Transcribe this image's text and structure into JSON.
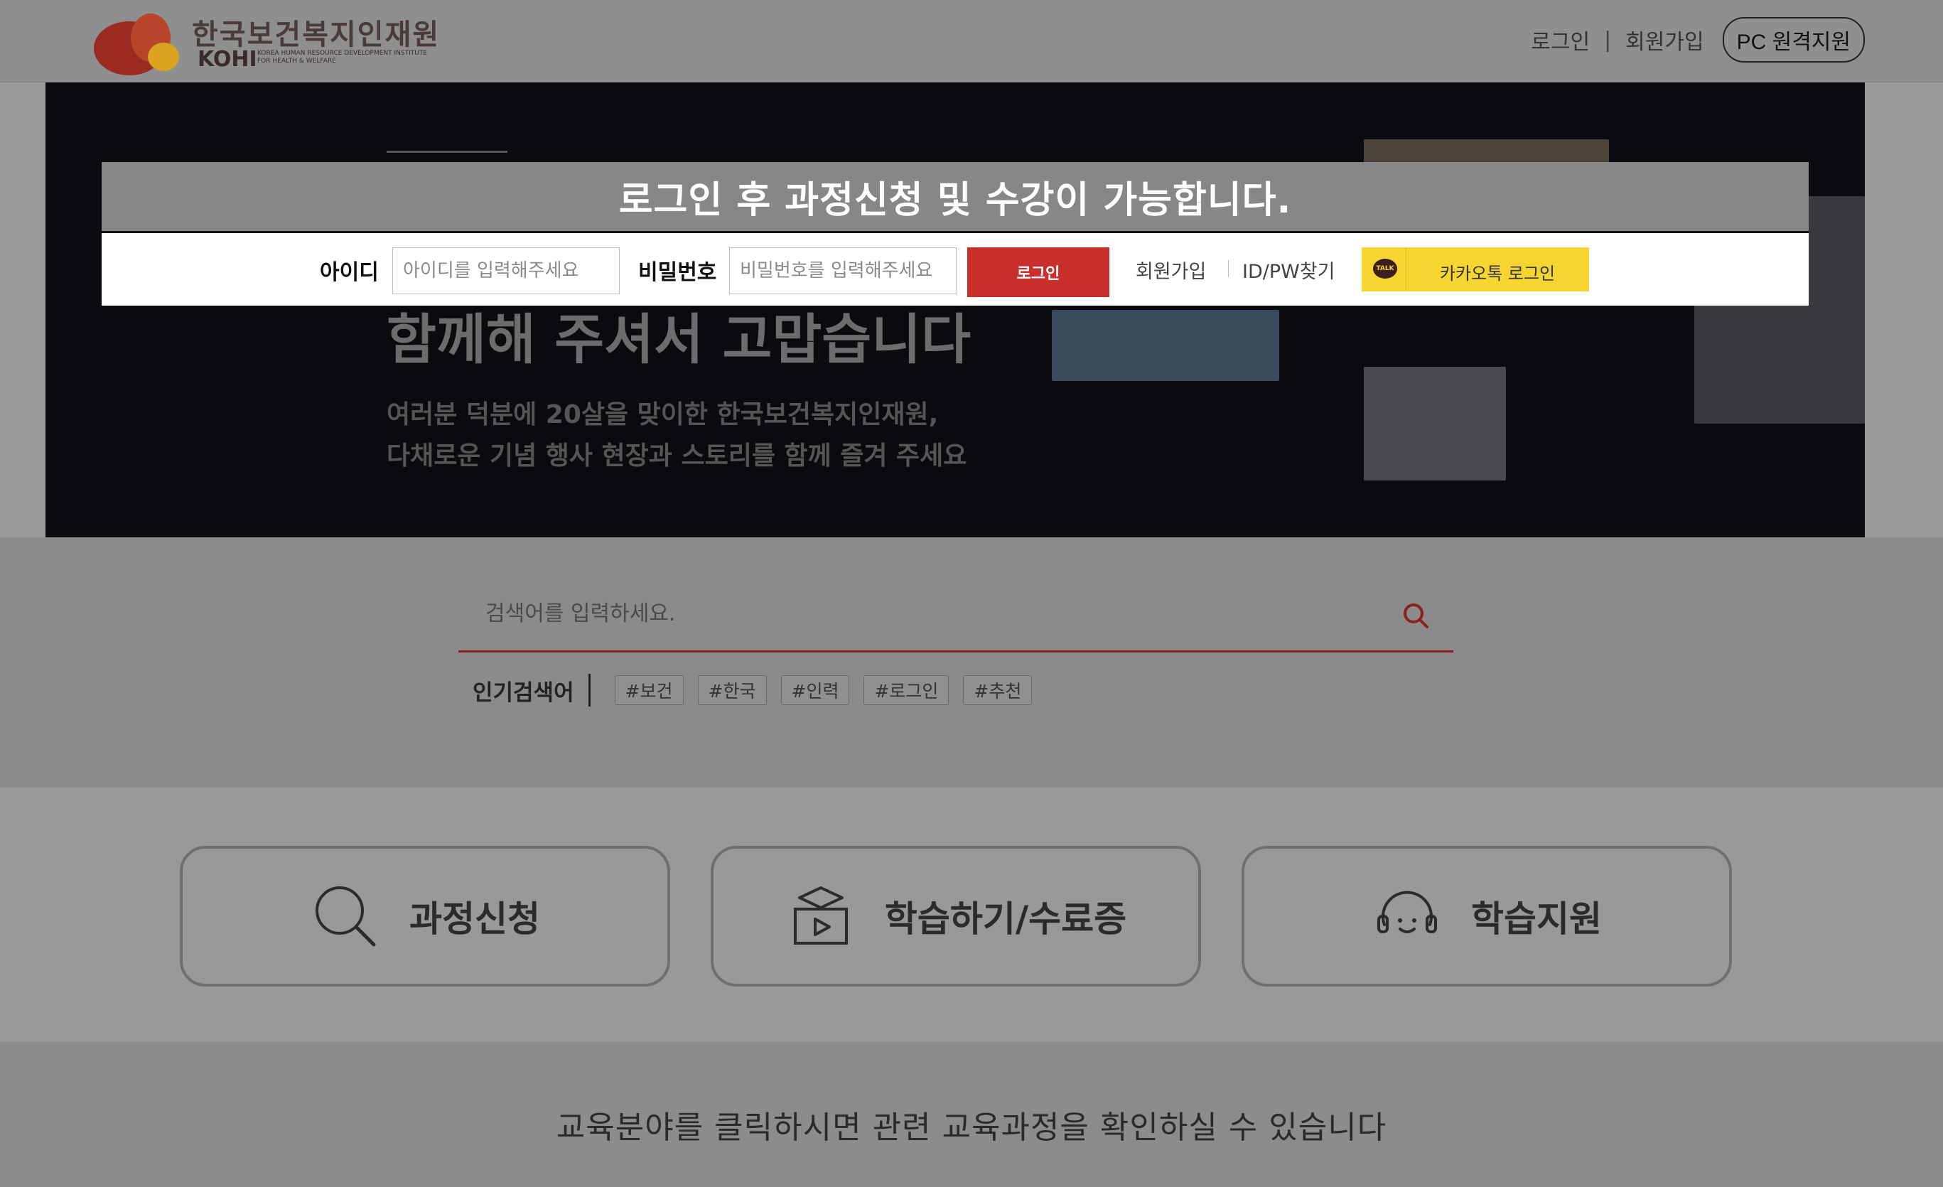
{
  "header": {
    "logo_ko": "한국보건복지인재원",
    "logo_en": "KOHI",
    "logo_sub": "KOREA HUMAN RESOURCE DEVELOPMENT INSTITUTE FOR HEALTH & WELFARE",
    "login_link": "로그인",
    "separator": "|",
    "signup_link": "회원가입",
    "pc_support": "PC 원격지원"
  },
  "banner": {
    "title": "함께해 주셔서 고맙습니다",
    "desc_line1": "여러분 덕분에 20살을 맞이한 한국보건복지인재원,",
    "desc_line2": "다채로운 기념 행사 현장과 스토리를 함께 즐겨 주세요"
  },
  "login": {
    "notice": "로그인 후 과정신청 및 수강이 가능합니다.",
    "id_label": "아이디",
    "id_placeholder": "아이디를 입력해주세요",
    "pw_label": "비밀번호",
    "pw_placeholder": "비밀번호를 입력해주세요",
    "submit": "로그인",
    "signup": "회원가입",
    "find": "ID/PW찾기",
    "kakao_badge": "TALK",
    "kakao": "카카오톡 로그인"
  },
  "search": {
    "placeholder": "검색어를 입력하세요.",
    "popular_label": "인기검색어",
    "tags": [
      "#보건",
      "#한국",
      "#인력",
      "#로그인",
      "#추천"
    ]
  },
  "actions": [
    {
      "label": "과정신청",
      "icon": "search-icon"
    },
    {
      "label": "학습하기/수료증",
      "icon": "graduation-video-icon"
    },
    {
      "label": "학습지원",
      "icon": "headset-icon"
    }
  ],
  "bottom": {
    "text": "교육분야를 클릭하시면 관련 교육과정을 확인하실 수 있습니다"
  },
  "colors": {
    "brand_red": "#c9302c",
    "kakao_yellow": "#f7d530",
    "search_underline": "#8e1f1f"
  }
}
